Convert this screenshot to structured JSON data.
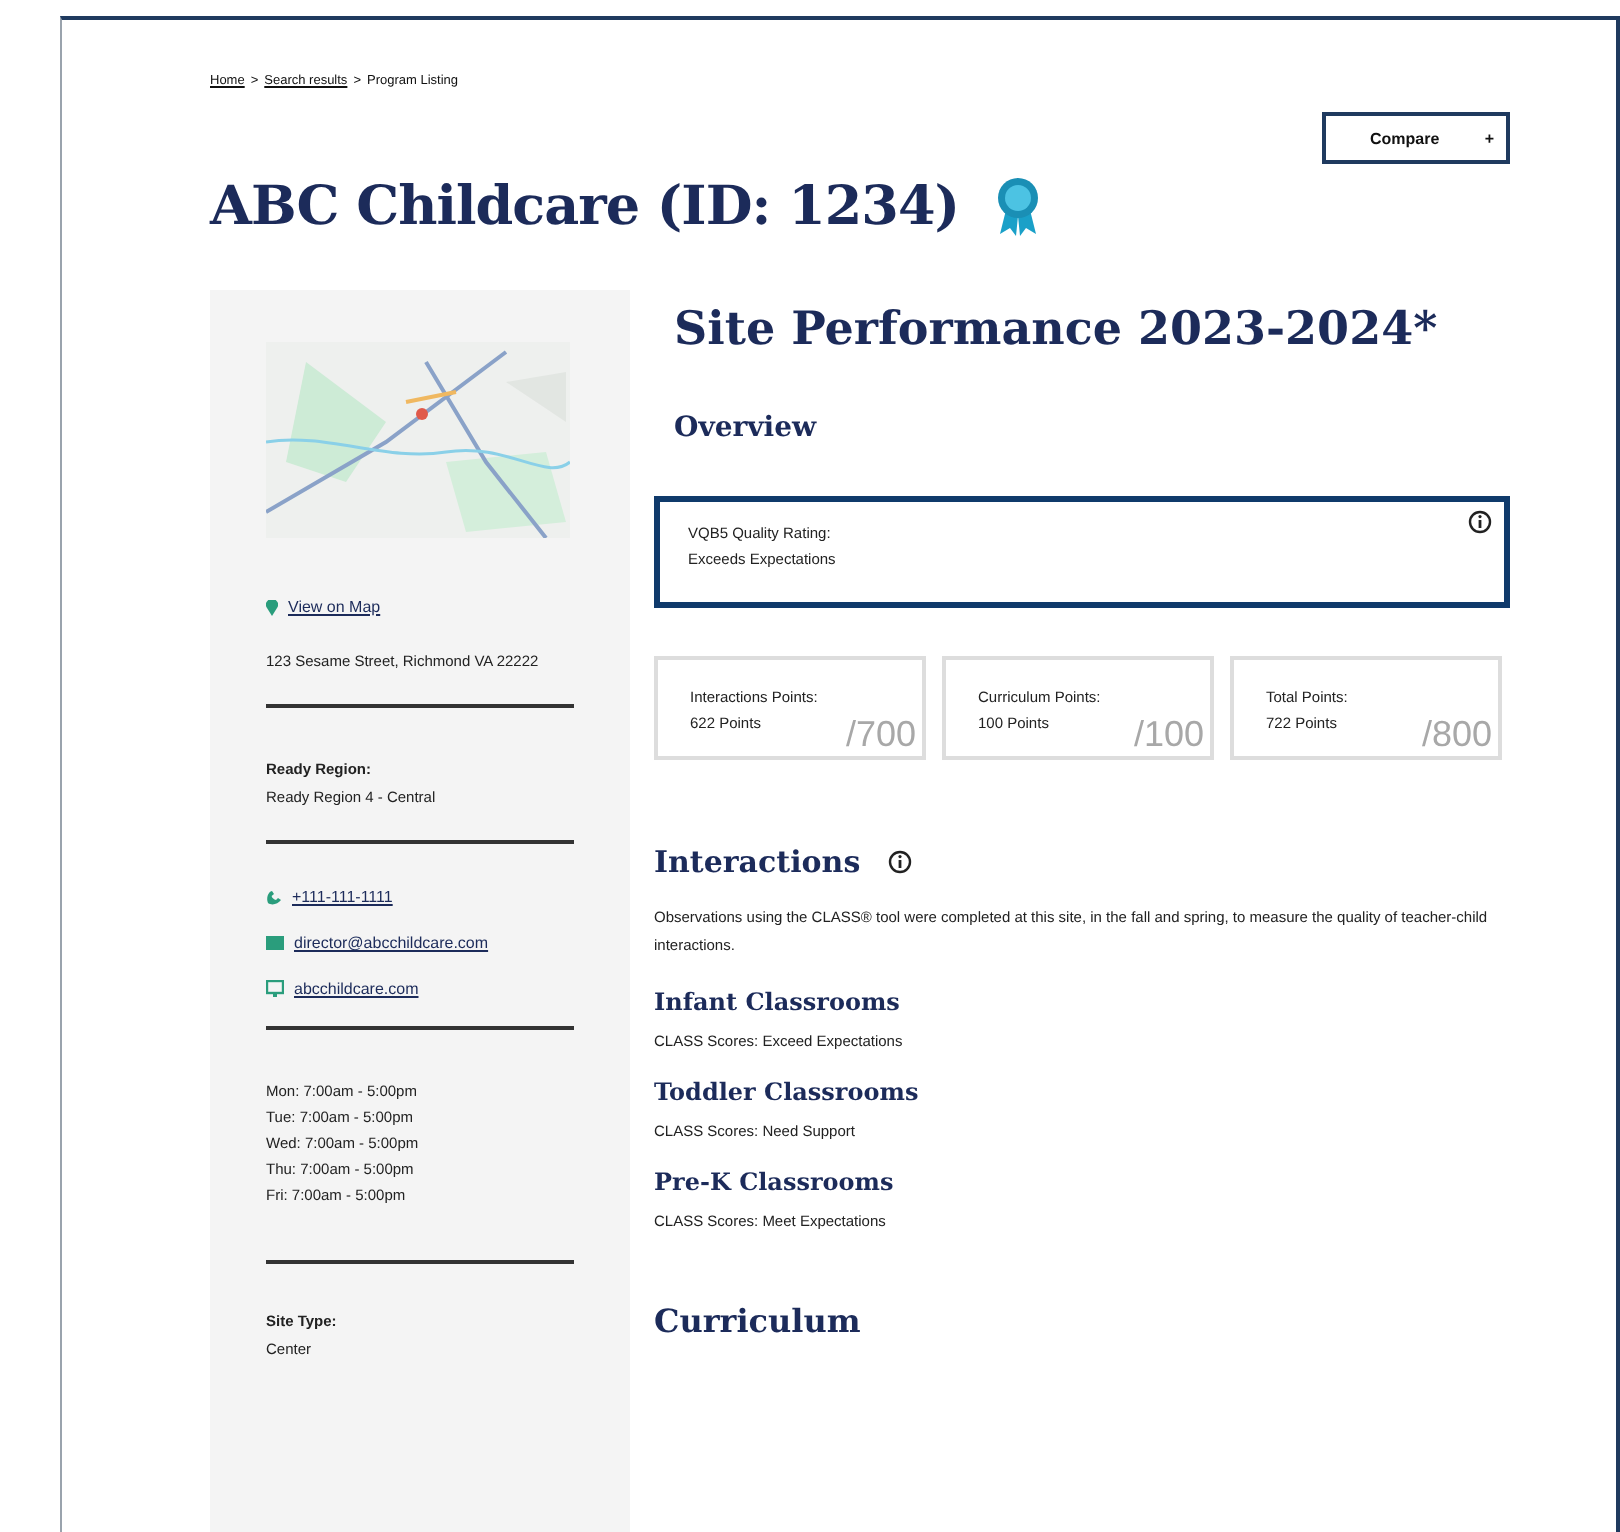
{
  "breadcrumb": {
    "separator": ">",
    "items": [
      {
        "label": "Home",
        "link": true
      },
      {
        "label": "Search results",
        "link": true
      },
      {
        "label": "Program Listing",
        "link": false
      }
    ]
  },
  "compare_button": {
    "label": "Compare",
    "icon": "+"
  },
  "title": "ABC Childcare (ID: 1234)",
  "sidebar": {
    "map_link": "View on Map",
    "address": "123 Sesame Street, Richmond VA 22222",
    "region_label": "Ready Region:",
    "region_value": "Ready Region 4 - Central",
    "contacts": [
      {
        "kind": "phone",
        "text": "+111-111-1111"
      },
      {
        "kind": "email",
        "text": "director@abcchildcare.com"
      },
      {
        "kind": "web",
        "text": "abcchildcare.com"
      }
    ],
    "hours": [
      "Mon: 7:00am - 5:00pm",
      "Tue: 7:00am - 5:00pm",
      "Wed: 7:00am - 5:00pm",
      "Thu: 7:00am - 5:00pm",
      "Fri: 7:00am - 5:00pm"
    ],
    "site_type_label": "Site Type:",
    "site_type_value": "Center"
  },
  "main": {
    "heading": "Site Performance 2023-2024*",
    "overview_heading": "Overview",
    "rating": {
      "label": "VQB5 Quality Rating:",
      "value": "Exceeds Expectations"
    },
    "points": [
      {
        "label": "Interactions Points:",
        "value": "622 Points",
        "max": "/700"
      },
      {
        "label": "Curriculum Points:",
        "value": "100 Points",
        "max": "/100"
      },
      {
        "label": "Total Points:",
        "value": "722 Points",
        "max": "/800"
      }
    ],
    "interactions": {
      "heading": "Interactions",
      "description": "Observations using the CLASS® tool were completed at this site, in the fall and spring, to measure the quality of teacher-child interactions.",
      "classrooms": [
        {
          "heading": "Infant Classrooms",
          "score": "CLASS Scores: Exceed Expectations"
        },
        {
          "heading": "Toddler Classrooms",
          "score": "CLASS Scores: Need Support"
        },
        {
          "heading": "Pre-K Classrooms",
          "score": "CLASS Scores: Meet Expectations"
        }
      ]
    },
    "curriculum_heading": "Curriculum"
  }
}
